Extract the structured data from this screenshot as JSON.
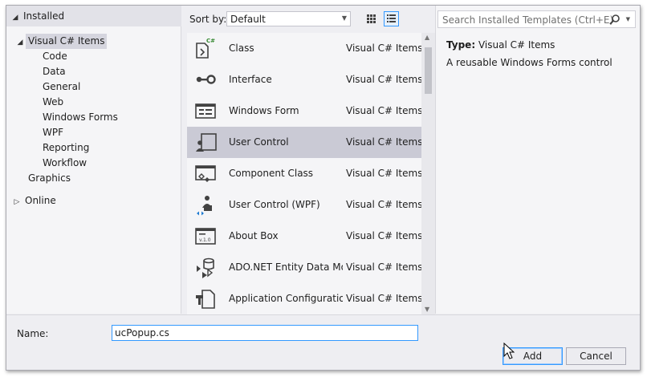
{
  "tree": {
    "header": {
      "label": "Installed",
      "expander": "◢"
    },
    "items": [
      {
        "label": "Visual C# Items",
        "expander": "◢",
        "level": 1,
        "selected": true
      },
      {
        "label": "Code",
        "level": 2
      },
      {
        "label": "Data",
        "level": 2
      },
      {
        "label": "General",
        "level": 2
      },
      {
        "label": "Web",
        "level": 2
      },
      {
        "label": "Windows Forms",
        "level": 2
      },
      {
        "label": "WPF",
        "level": 2
      },
      {
        "label": "Reporting",
        "level": 2
      },
      {
        "label": "Workflow",
        "level": 2
      },
      {
        "label": "Graphics",
        "level": 1
      }
    ],
    "online": {
      "label": "Online",
      "expander": "▷"
    }
  },
  "toolbar": {
    "sort_label": "Sort by:",
    "sort_value": "Default",
    "views": [
      "small-icons-view",
      "list-view"
    ]
  },
  "templates": [
    {
      "name": "Class",
      "category": "Visual C# Items",
      "icon": "class-icon"
    },
    {
      "name": "Interface",
      "category": "Visual C# Items",
      "icon": "interface-icon"
    },
    {
      "name": "Windows Form",
      "category": "Visual C# Items",
      "icon": "windows-form-icon"
    },
    {
      "name": "User Control",
      "category": "Visual C# Items",
      "icon": "user-control-icon",
      "selected": true
    },
    {
      "name": "Component Class",
      "category": "Visual C# Items",
      "icon": "component-class-icon"
    },
    {
      "name": "User Control (WPF)",
      "category": "Visual C# Items",
      "icon": "user-control-wpf-icon"
    },
    {
      "name": "About Box",
      "category": "Visual C# Items",
      "icon": "about-box-icon"
    },
    {
      "name": "ADO.NET Entity Data Mo...",
      "category": "Visual C# Items",
      "icon": "entity-data-model-icon"
    },
    {
      "name": "Application Configuratio...",
      "category": "Visual C# Items",
      "icon": "app-config-icon"
    }
  ],
  "search": {
    "placeholder": "Search Installed Templates (Ctrl+E)"
  },
  "details": {
    "type_key": "Type:",
    "type_value": "Visual C# Items",
    "description": "A reusable Windows Forms control"
  },
  "bottom": {
    "name_label": "Name:",
    "name_value": "ucPopup.cs",
    "add_label": "Add",
    "cancel_label": "Cancel"
  },
  "colors": {
    "accent": "#3399ff",
    "selection": "#cacad5",
    "dialog_bg": "#eeeef2"
  }
}
